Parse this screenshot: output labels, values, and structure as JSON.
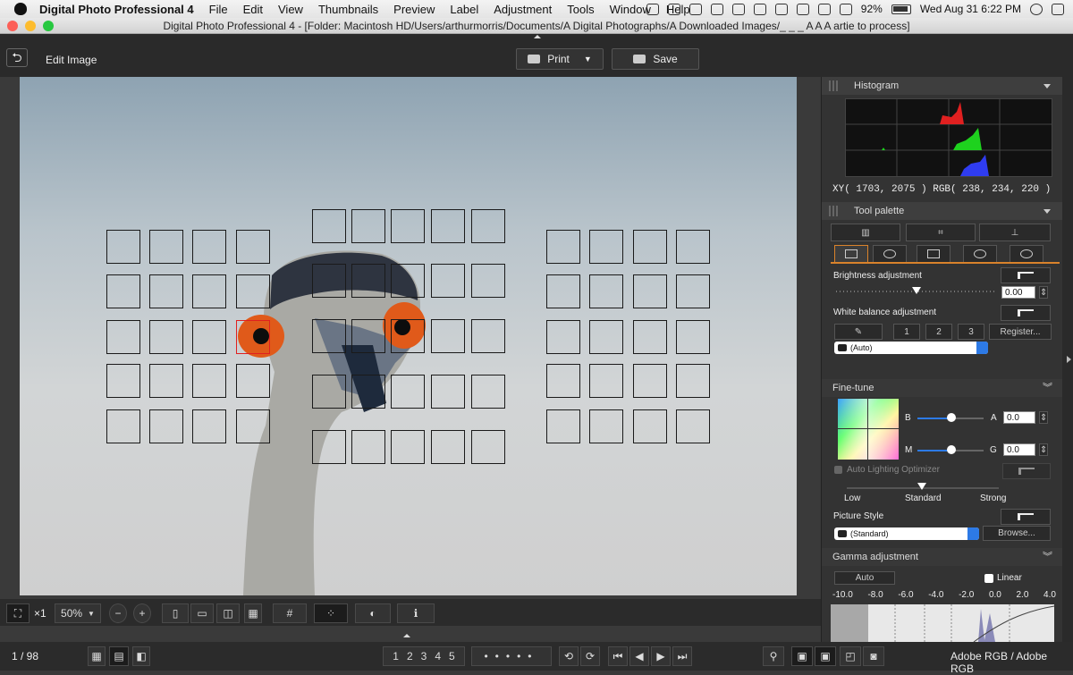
{
  "menubar": {
    "app_name": "Digital Photo Professional 4",
    "items": [
      "File",
      "Edit",
      "View",
      "Thumbnails",
      "Preview",
      "Label",
      "Adjustment",
      "Tools",
      "Window",
      "Help"
    ],
    "battery": "92%",
    "clock": "Wed Aug 31  6:22 PM"
  },
  "window": {
    "title": "Digital Photo Professional 4 - [Folder: Macintosh HD/Users/arthurmorris/Documents/A Digital Photographs/A Downloaded Images/_ _ _ A A A artie to process]"
  },
  "toolbar": {
    "mode_label": "Edit Image",
    "print_label": "Print",
    "save_label": "Save"
  },
  "viewer": {
    "zoom_multiplier": "×1",
    "zoom_value": "50%"
  },
  "status": {
    "image_counter": "1 / 98",
    "color_space": "Adobe RGB / Adobe RGB",
    "rating_labels": [
      "1",
      "2",
      "3",
      "4",
      "5"
    ]
  },
  "panel": {
    "histogram_title": "Histogram",
    "histogram_readout": "XY(  1703,   2075 ) RGB( 238,  234,  220 )",
    "tool_palette_title": "Tool palette",
    "brightness_label": "Brightness adjustment",
    "brightness_value": "0.00",
    "wb_label": "White balance adjustment",
    "wb_presets": [
      "1",
      "2",
      "3"
    ],
    "register_label": "Register...",
    "wb_mode": "(Auto)",
    "finetune_title": "Fine-tune",
    "finetune_b": "B",
    "finetune_a": "A",
    "finetune_a_value": "0.0",
    "finetune_m": "M",
    "finetune_g": "G",
    "finetune_g_value": "0.0",
    "alo_label": "Auto Lighting Optimizer",
    "alo_levels": [
      "Low",
      "Standard",
      "Strong"
    ],
    "picture_style_label": "Picture Style",
    "picture_style_value": "(Standard)",
    "browse_label": "Browse...",
    "gamma_title": "Gamma adjustment",
    "gamma_auto": "Auto",
    "gamma_linear": "Linear",
    "gamma_scale": [
      "-10.0",
      "-8.0",
      "-6.0",
      "-4.0",
      "-2.0",
      "0.0",
      "2.0",
      "4.0"
    ]
  }
}
